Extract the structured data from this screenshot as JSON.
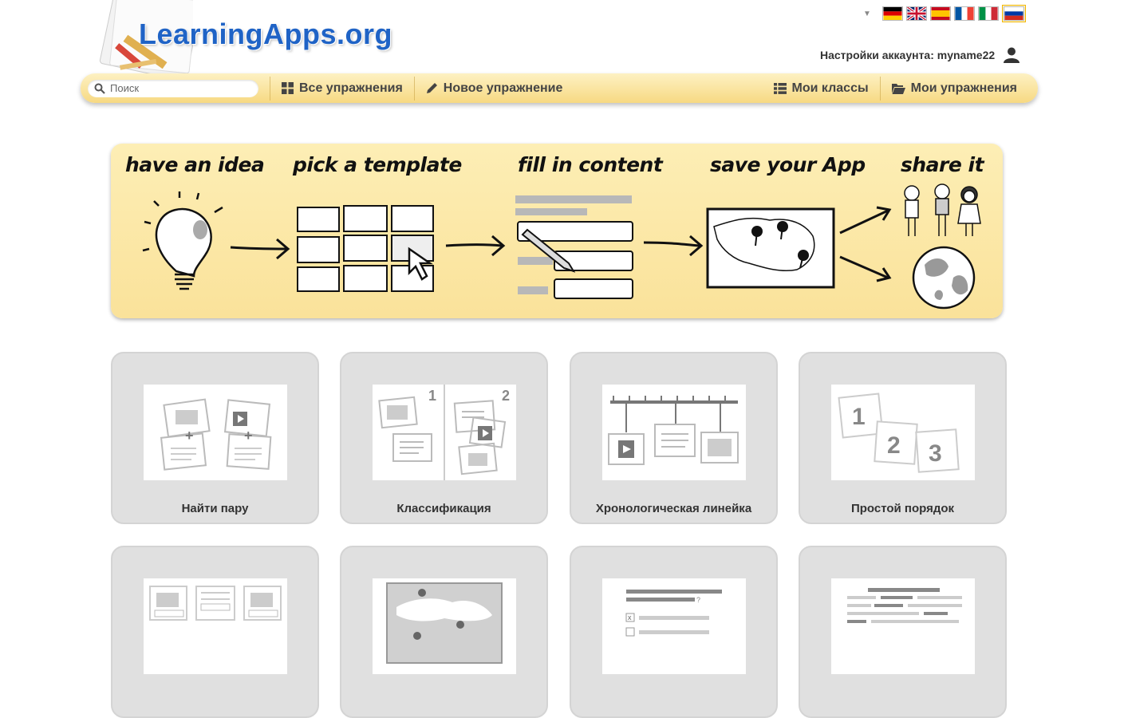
{
  "logo": {
    "text": "LearningApps.org"
  },
  "header": {
    "account_label": "Настройки аккаунта: myname22",
    "languages": [
      "de",
      "en",
      "es",
      "fr",
      "it",
      "ru"
    ]
  },
  "nav": {
    "search_placeholder": "Поиск",
    "all_exercises": "Все упражнения",
    "new_exercise": "Новое упражнение",
    "my_classes": "Мои классы",
    "my_exercises": "Мои упражнения"
  },
  "banner": {
    "steps": [
      "have an idea",
      "pick a template",
      "fill in content",
      "save your App",
      "share it"
    ]
  },
  "templates": [
    {
      "label": "Найти пару"
    },
    {
      "label": "Классификация"
    },
    {
      "label": "Хронологическая линейка"
    },
    {
      "label": "Простой порядок"
    },
    {
      "label": ""
    },
    {
      "label": ""
    },
    {
      "label": ""
    },
    {
      "label": ""
    }
  ],
  "colors": {
    "nav_bg": "#f7d982",
    "banner_bg": "#fae29a",
    "card_bg": "#e0e0e0",
    "logo_blue": "#1f63c6"
  }
}
